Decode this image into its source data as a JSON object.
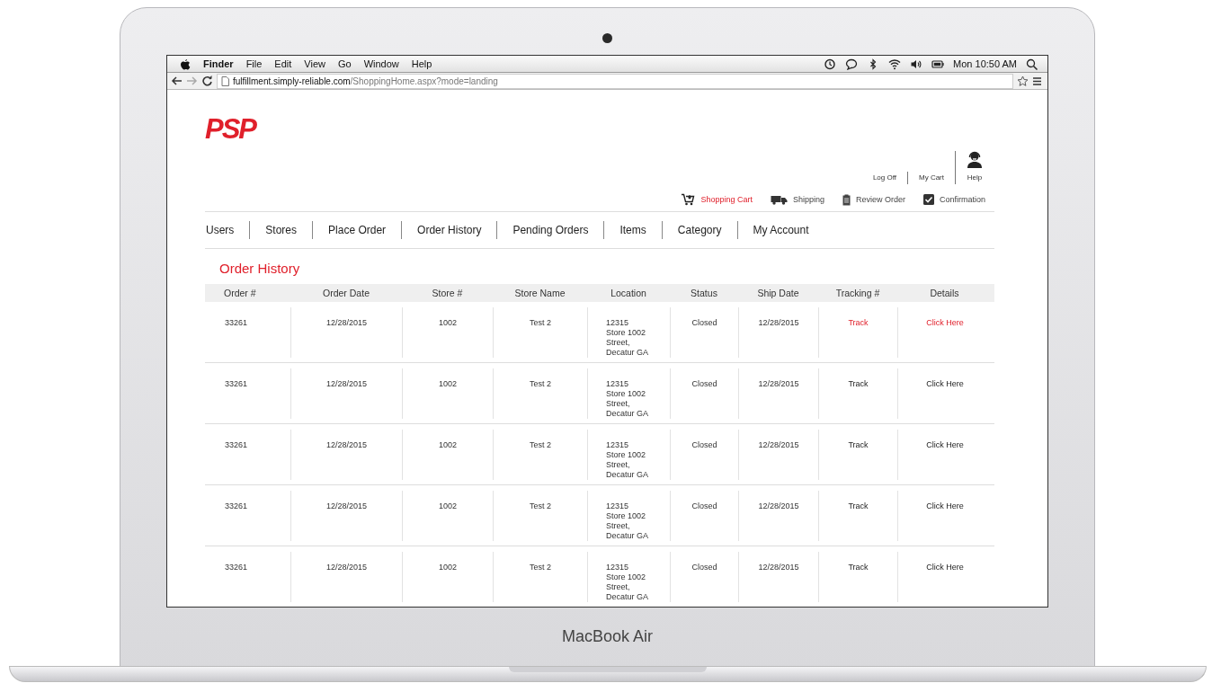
{
  "menu_bar": {
    "app": "Finder",
    "menus": [
      "File",
      "Edit",
      "View",
      "Go",
      "Window",
      "Help"
    ],
    "clock": "Mon 10:50 AM"
  },
  "browser": {
    "url_host": "fulfillment.simply-reliable.com",
    "url_path": "/ShoppingHome.aspx?mode=landing"
  },
  "logo": "PSP",
  "account_links": [
    "Log Off",
    "My Cart",
    "Help"
  ],
  "steps": [
    {
      "label": "Shopping Cart",
      "kind": "cart",
      "selected": true
    },
    {
      "label": "Shipping",
      "kind": "truck",
      "selected": false
    },
    {
      "label": "Review Order",
      "kind": "clipboard",
      "selected": false
    },
    {
      "label": "Confirmation",
      "kind": "check",
      "selected": false
    }
  ],
  "nav": [
    "Users",
    "Stores",
    "Place Order",
    "Order History",
    "Pending Orders",
    "Items",
    "Category",
    "My Account"
  ],
  "page_title": "Order History",
  "table": {
    "columns": [
      "Order #",
      "Order Date",
      "Store #",
      "Store Name",
      "Location",
      "Status",
      "Ship Date",
      "Tracking #",
      "Details"
    ],
    "rows": [
      {
        "cells": [
          "33261",
          "12/28/2015",
          "1002",
          "Test 2",
          "12315\nStore 1002\nStreet,\nDecatur GA",
          "Closed",
          "12/28/2015",
          "Track",
          "Click Here"
        ],
        "highlighted": true
      },
      {
        "cells": [
          "33261",
          "12/28/2015",
          "1002",
          "Test 2",
          "12315\nStore 1002\nStreet,\nDecatur GA",
          "Closed",
          "12/28/2015",
          "Track",
          "Click Here"
        ],
        "highlighted": false
      },
      {
        "cells": [
          "33261",
          "12/28/2015",
          "1002",
          "Test 2",
          "12315\nStore 1002\nStreet,\nDecatur GA",
          "Closed",
          "12/28/2015",
          "Track",
          "Click Here"
        ],
        "highlighted": false
      },
      {
        "cells": [
          "33261",
          "12/28/2015",
          "1002",
          "Test 2",
          "12315\nStore 1002\nStreet,\nDecatur GA",
          "Closed",
          "12/28/2015",
          "Track",
          "Click Here"
        ],
        "highlighted": false
      },
      {
        "cells": [
          "33261",
          "12/28/2015",
          "1002",
          "Test 2",
          "12315\nStore 1002\nStreet,\nDecatur GA",
          "Closed",
          "12/28/2015",
          "Track",
          "Click Here"
        ],
        "highlighted": false
      }
    ]
  },
  "laptop_label": "MacBook Air"
}
